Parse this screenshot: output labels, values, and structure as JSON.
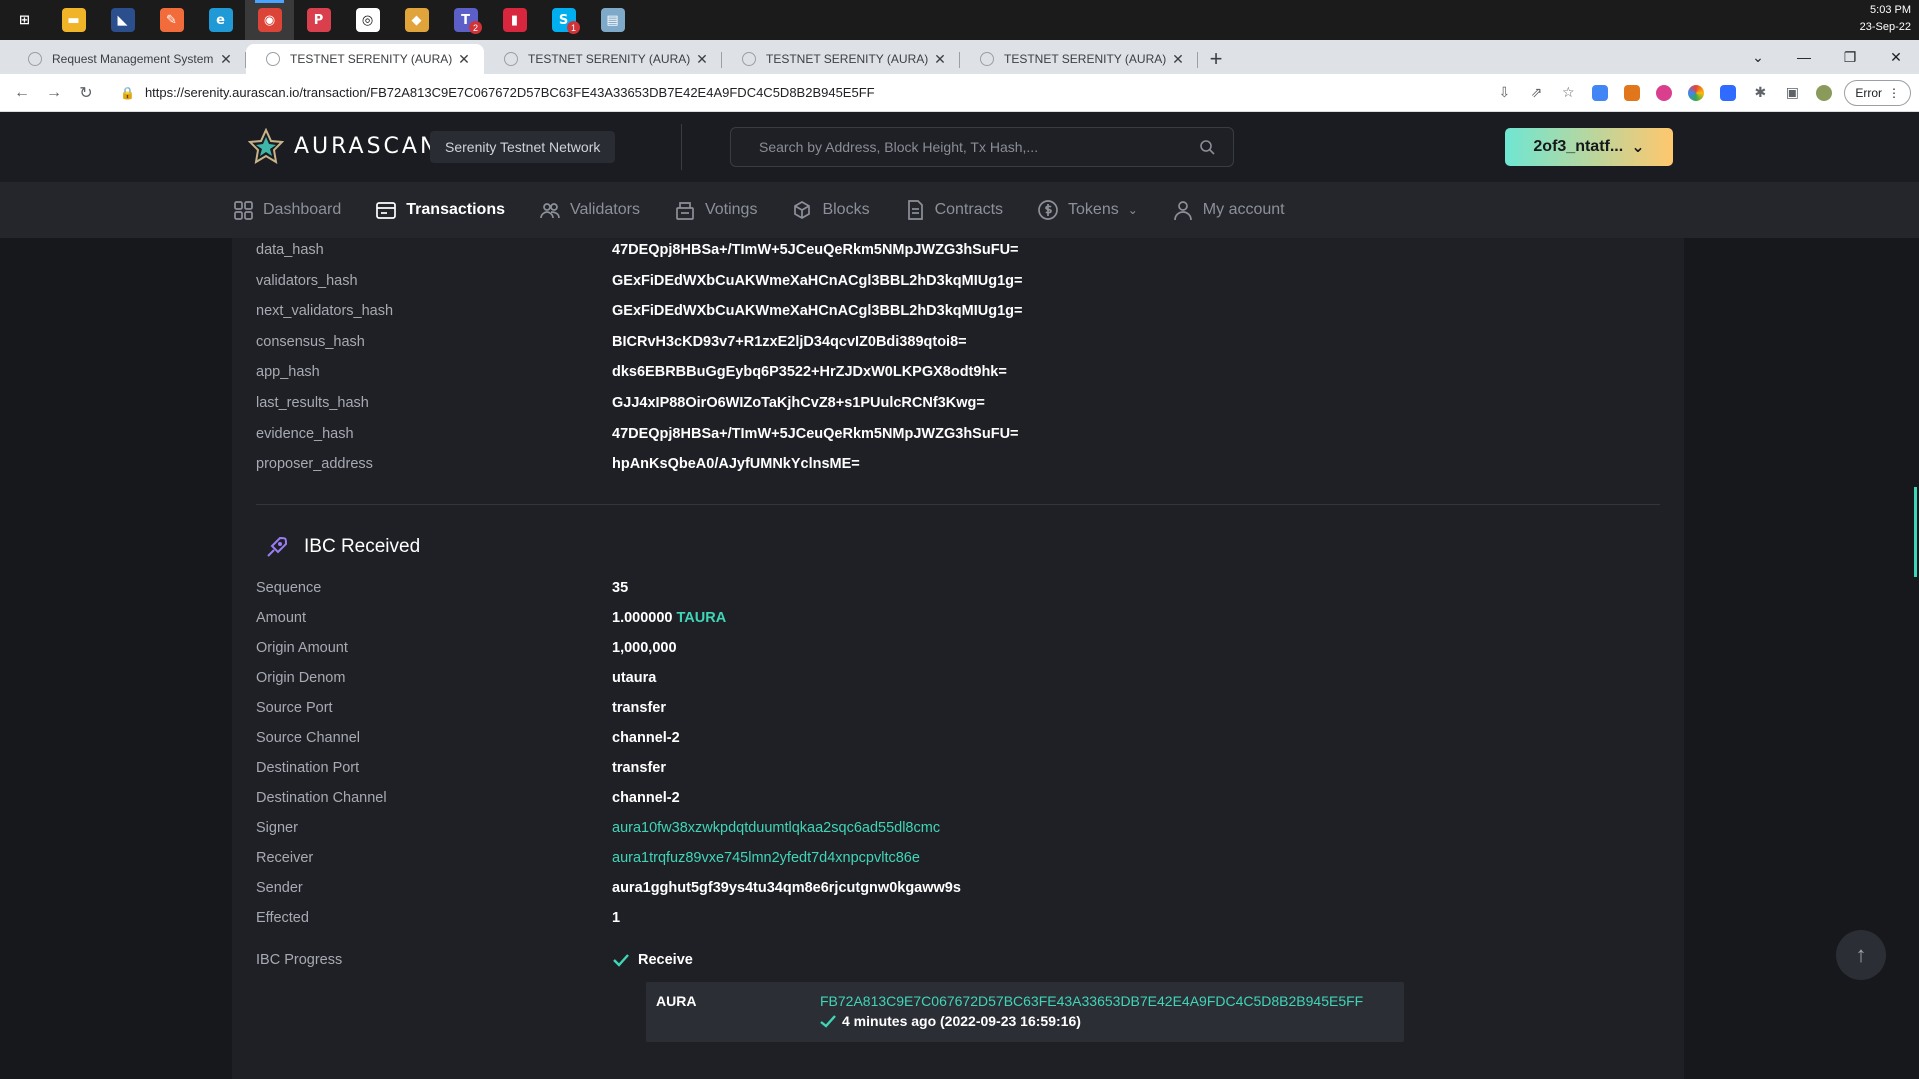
{
  "taskbar": {
    "icons": [
      {
        "name": "windows-start-icon",
        "glyph": "⊞",
        "color": "#1b1b1b"
      },
      {
        "name": "file-explorer-icon",
        "glyph": "▬",
        "color": "#f0b429"
      },
      {
        "name": "app-blue-icon",
        "glyph": "◣",
        "color": "#2b4e8c"
      },
      {
        "name": "postman-icon",
        "glyph": "✎",
        "color": "#f26b3a"
      },
      {
        "name": "edge-icon",
        "glyph": "e",
        "color": "#1f9ad6"
      },
      {
        "name": "chrome-icon",
        "glyph": "◉",
        "color": "#db4437"
      },
      {
        "name": "pdf-app-icon",
        "glyph": "P",
        "color": "#d93f4c"
      },
      {
        "name": "github-icon",
        "glyph": "◎",
        "color": "#ffffff"
      },
      {
        "name": "git-icon",
        "glyph": "◆",
        "color": "#e0a43a"
      },
      {
        "name": "teams-icon",
        "glyph": "T",
        "color": "#5b5fc7",
        "badge": "2"
      },
      {
        "name": "app-bars-icon",
        "glyph": "▮",
        "color": "#d7263d"
      },
      {
        "name": "skype-icon",
        "glyph": "S",
        "color": "#00aff0",
        "badge": "1"
      },
      {
        "name": "notes-icon",
        "glyph": "▤",
        "color": "#7fa9c9"
      }
    ],
    "time": "5:03 PM",
    "date": "23-Sep-22"
  },
  "browser": {
    "tabs": [
      {
        "title": "Request Management System",
        "active": false
      },
      {
        "title": "TESTNET SERENITY (AURA) Block",
        "active": true
      },
      {
        "title": "TESTNET SERENITY (AURA) Block",
        "active": false
      },
      {
        "title": "TESTNET SERENITY (AURA) Block",
        "active": false
      },
      {
        "title": "TESTNET SERENITY (AURA) Block",
        "active": false
      }
    ],
    "url": "https://serenity.aurascan.io/transaction/FB72A813C9E7C067672D57BC63FE43A33653DB7E42E4A9FDC4C5D8B2B945E5FF",
    "error_label": "Error"
  },
  "header": {
    "logo_text": "AURASCAN",
    "network": "Serenity Testnet Network",
    "search_placeholder": "Search by Address, Block Height, Tx Hash,...",
    "wallet_label": "2of3_ntatf..."
  },
  "nav": [
    {
      "label": "Dashboard",
      "icon": "dashboard-icon",
      "active": false
    },
    {
      "label": "Transactions",
      "icon": "transactions-icon",
      "active": true
    },
    {
      "label": "Validators",
      "icon": "validators-icon",
      "active": false
    },
    {
      "label": "Votings",
      "icon": "votings-icon",
      "active": false
    },
    {
      "label": "Blocks",
      "icon": "blocks-icon",
      "active": false
    },
    {
      "label": "Contracts",
      "icon": "contracts-icon",
      "active": false
    },
    {
      "label": "Tokens",
      "icon": "tokens-icon",
      "active": false
    },
    {
      "label": "My account",
      "icon": "account-icon",
      "active": false
    }
  ],
  "header_hashes": [
    {
      "key": "data_hash",
      "value": "47DEQpj8HBSa+/TImW+5JCeuQeRkm5NMpJWZG3hSuFU="
    },
    {
      "key": "validators_hash",
      "value": "GExFiDEdWXbCuAKWmeXaHCnACgl3BBL2hD3kqMIUg1g="
    },
    {
      "key": "next_validators_hash",
      "value": "GExFiDEdWXbCuAKWmeXaHCnACgl3BBL2hD3kqMIUg1g="
    },
    {
      "key": "consensus_hash",
      "value": "BICRvH3cKD93v7+R1zxE2ljD34qcvIZ0Bdi389qtoi8="
    },
    {
      "key": "app_hash",
      "value": "dks6EBRBBuGgEybq6P3522+HrZJDxW0LKPGX8odt9hk="
    },
    {
      "key": "last_results_hash",
      "value": "GJJ4xIP88OirO6WIZoTaKjhCvZ8+s1PUulcRCNf3Kwg="
    },
    {
      "key": "evidence_hash",
      "value": "47DEQpj8HBSa+/TImW+5JCeuQeRkm5NMpJWZG3hSuFU="
    },
    {
      "key": "proposer_address",
      "value": "hpAnKsQbeA0/AJyfUMNkYclnsME="
    }
  ],
  "ibc": {
    "title": "IBC Received",
    "sequence_label": "Sequence",
    "sequence": "35",
    "amount_label": "Amount",
    "amount": "1.000000",
    "amount_denom": "TAURA",
    "origin_amount_label": "Origin Amount",
    "origin_amount": "1,000,000",
    "origin_denom_label": "Origin Denom",
    "origin_denom": "utaura",
    "source_port_label": "Source Port",
    "source_port": "transfer",
    "source_channel_label": "Source Channel",
    "source_channel": "channel-2",
    "dest_port_label": "Destination Port",
    "dest_port": "transfer",
    "dest_channel_label": "Destination Channel",
    "dest_channel": "channel-2",
    "signer_label": "Signer",
    "signer": "aura10fw38xzwkpdqtduumtlqkaa2sqc6ad55dl8cmc",
    "receiver_label": "Receiver",
    "receiver": "aura1trqfuz89vxe745lmn2yfedt7d4xnpcpvltc86e",
    "sender_label": "Sender",
    "sender": "aura1gghut5gf39ys4tu34qm8e6rjcutgnw0kgaww9s",
    "effected_label": "Effected",
    "effected": "1",
    "progress_label": "IBC Progress",
    "progress_status": "Receive",
    "progress_chain": "AURA",
    "progress_hash": "FB72A813C9E7C067672D57BC63FE43A33653DB7E42E4A9FDC4C5D8B2B945E5FF",
    "progress_time": "4 minutes ago (2022-09-23 16:59:16)"
  },
  "colors": {
    "accent": "#3fd6b8",
    "panel": "#1f2026",
    "nav_bg": "#24262c"
  }
}
